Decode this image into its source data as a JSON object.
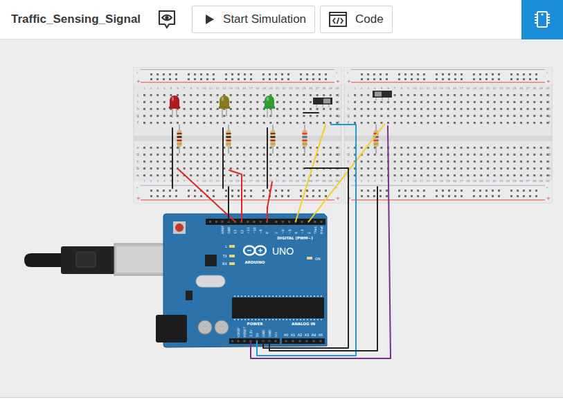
{
  "window": {
    "title": "Traffic_Sensing_Signal"
  },
  "toolbar": {
    "buttons": [
      {
        "label": "Start Simulation"
      },
      {
        "label": "Code"
      }
    ]
  },
  "breadboards": [
    {
      "columns": [
        "1",
        "2",
        "3",
        "4",
        "5",
        "6",
        "7",
        "8",
        "9",
        "10",
        "11",
        "12",
        "13",
        "14",
        "15",
        "16",
        "17",
        "18",
        "19",
        "20",
        "21",
        "22",
        "23",
        "24",
        "25",
        "26",
        "27",
        "28",
        "29",
        "30"
      ],
      "rows_top": [
        "j",
        "i",
        "h",
        "g",
        "f"
      ],
      "rows_bottom": [
        "e",
        "d",
        "c",
        "b",
        "a"
      ],
      "rail_minus": "-",
      "rail_plus": "+"
    },
    {
      "columns": [
        "1",
        "2",
        "3",
        "4",
        "5",
        "6",
        "7",
        "8",
        "9",
        "10",
        "11",
        "12",
        "13",
        "14",
        "15",
        "16",
        "17",
        "18",
        "19",
        "20",
        "21",
        "22",
        "23",
        "24",
        "25",
        "26",
        "27",
        "28",
        "29",
        "30"
      ],
      "rows_top": [
        "j",
        "i",
        "h",
        "g",
        "f"
      ],
      "rows_bottom": [
        "e",
        "d",
        "c",
        "b",
        "a"
      ],
      "rail_minus": "-",
      "rail_plus": "+"
    }
  ],
  "leds": [
    {
      "color": "#b01c1c"
    },
    {
      "color": "#8c7b1c"
    },
    {
      "color": "#2e9e34"
    }
  ],
  "switches": [
    {
      "on": true
    },
    {
      "on": false
    }
  ],
  "arduino": {
    "brand": "ARDUINO",
    "model": "UNO",
    "digital_header": "DIGITAL (PWM~)",
    "power_header": "POWER",
    "analog_header": "ANALOG IN",
    "digital_pins": [
      "AREF",
      "GND",
      "13",
      "12",
      "~11",
      "~10",
      "~9",
      "8",
      "7",
      "~6",
      "~5",
      "4",
      "~3",
      "2",
      "TX▸1",
      "RX◂0"
    ],
    "power_pins": [
      "IOREF",
      "RESET",
      "3.3V",
      "5V",
      "GND",
      "GND",
      "Vin"
    ],
    "analog_pins": [
      "A0",
      "A1",
      "A2",
      "A3",
      "A4",
      "A5"
    ],
    "indicators": [
      {
        "label": "L"
      },
      {
        "label": "TX"
      },
      {
        "label": "RX"
      }
    ],
    "power_indicator": "ON"
  },
  "wires": [
    {
      "color": "#222222"
    },
    {
      "color": "#222222"
    },
    {
      "color": "#222222"
    },
    {
      "color": "#e02424"
    },
    {
      "color": "#e02424"
    },
    {
      "color": "#e02424"
    },
    {
      "color": "#222222"
    },
    {
      "color": "#f0d020"
    },
    {
      "color": "#f0d020"
    },
    {
      "color": "#222222"
    },
    {
      "color": "#1a9ad6"
    },
    {
      "color": "#7b2d8e"
    },
    {
      "color": "#222222"
    },
    {
      "color": "#222222"
    }
  ]
}
